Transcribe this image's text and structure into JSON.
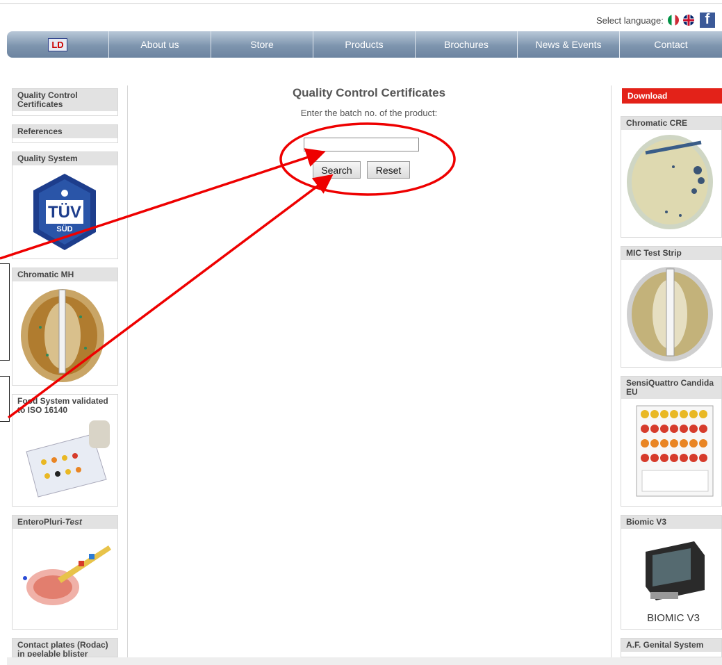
{
  "header": {
    "select_language": "Select language:",
    "facebook_icon_letter": "f"
  },
  "nav": {
    "logo_text": "LD",
    "items": [
      "About us",
      "Store",
      "Products",
      "Brochures",
      "News & Events",
      "Contact"
    ]
  },
  "main": {
    "title": "Quality Control Certificates",
    "subtitle": "Enter the batch no. of the product:",
    "batch_value": "",
    "search_label": "Search",
    "reset_label": "Reset"
  },
  "left_sidebar": {
    "qcc": "Quality Control Certificates",
    "references": "References",
    "quality_system": "Quality System",
    "tuv_main": "TÜV",
    "tuv_sub": "SÜD",
    "chromatic_mh": "Chromatic MH",
    "food_system": "Food System validated to ISO 16140",
    "enteropluri_prefix": "EnteroPluri-",
    "enteropluri_suffix": "Test",
    "contact_plates": "Contact plates (Rodac) in peelable blister"
  },
  "right_sidebar": {
    "download": "Download",
    "chromatic_cre": "Chromatic CRE",
    "mic_test_strip": "MIC Test Strip",
    "sensiquattro": "SensiQuattro Candida EU",
    "biomic": "Biomic V3",
    "biomic_logo": "BIOMIC V3",
    "af_genital": "A.F. Genital System"
  },
  "colors": {
    "accent_red": "#e32219",
    "annotation_red": "#ee0000",
    "nav_blue": "#7e95ae"
  }
}
